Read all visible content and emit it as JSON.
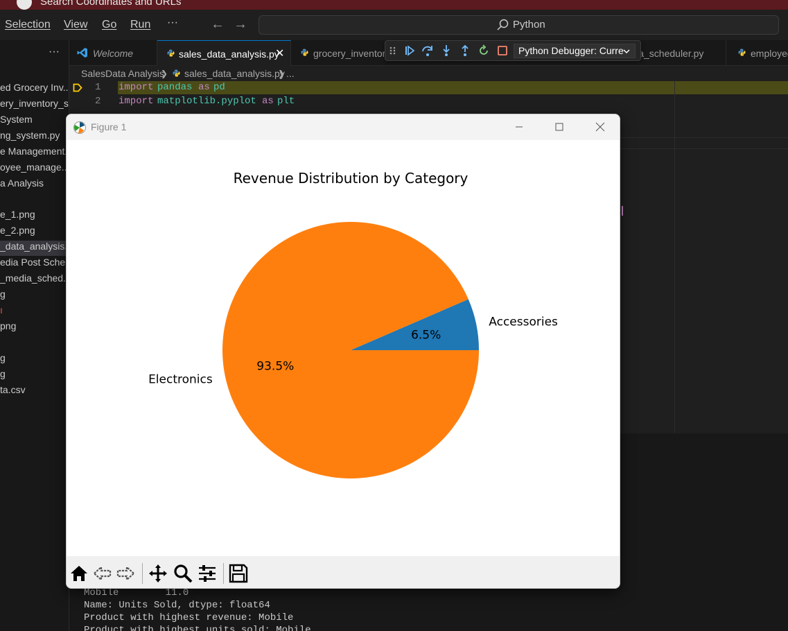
{
  "window": {
    "title": "Search Coordinates and URLs"
  },
  "menu": {
    "selection": "Selection",
    "view": "View",
    "go": "Go",
    "run": "Run",
    "more": "···"
  },
  "command_center": {
    "text": "Python"
  },
  "sidebar": {
    "more": "···",
    "items": [
      {
        "label": "ed Grocery Inv..."
      },
      {
        "label": "ery_inventory_s..."
      },
      {
        "label": "System"
      },
      {
        "label": "ng_system.py"
      },
      {
        "label": "e Management..."
      },
      {
        "label": "oyee_manage..."
      },
      {
        "label": "a Analysis"
      },
      {
        "label": "e_1.png"
      },
      {
        "label": "e_2.png"
      },
      {
        "label": "_data_analysis.py"
      },
      {
        "label": "edia Post Sche..."
      },
      {
        "label": "_media_sched..."
      },
      {
        "label": "g"
      },
      {
        "label": "ı"
      },
      {
        "label": "png"
      },
      {
        "label": "g"
      },
      {
        "label": "g"
      },
      {
        "label": "ta.csv"
      }
    ]
  },
  "tabs": [
    {
      "label": "Welcome"
    },
    {
      "label": "sales_data_analysis.py",
      "close": "✕"
    },
    {
      "label": "grocery_inventor"
    },
    {
      "label": "lia_scheduler.py"
    },
    {
      "label": "employee"
    }
  ],
  "debug": {
    "config": "Python Debugger: Curre"
  },
  "breadcrumb": {
    "folder": "SalesData Analysis",
    "file": "sales_data_analysis.py",
    "more": "..."
  },
  "editor": {
    "lines": [
      {
        "num": "1",
        "kw": "import",
        "mod": "pandas",
        "as": "as",
        "alias": "pd"
      },
      {
        "num": "2",
        "kw": "import",
        "mod": "matplotlib.pyplot",
        "as": "as",
        "alias": "plt"
      }
    ]
  },
  "terminal": {
    "lines": [
      "Mobile        11.0",
      "Name: Units Sold, dtype: float64",
      "Product with highest revenue: Mobile",
      "Product with highest units sold: Mobile"
    ]
  },
  "figure": {
    "title": "Figure 1"
  },
  "chart_data": {
    "type": "pie",
    "title": "Revenue Distribution by Category",
    "labels": [
      "Accessories",
      "Electronics"
    ],
    "values": [
      6.5,
      93.5
    ],
    "pct_labels": [
      "6.5%",
      "93.5%"
    ],
    "colors": [
      "#1f77b4",
      "#ff7f0e"
    ],
    "start_angle_deg": 0
  },
  "colors": {
    "accent": "#0078d4",
    "pie_blue": "#1f77b4",
    "pie_orange": "#ff7f0e"
  }
}
